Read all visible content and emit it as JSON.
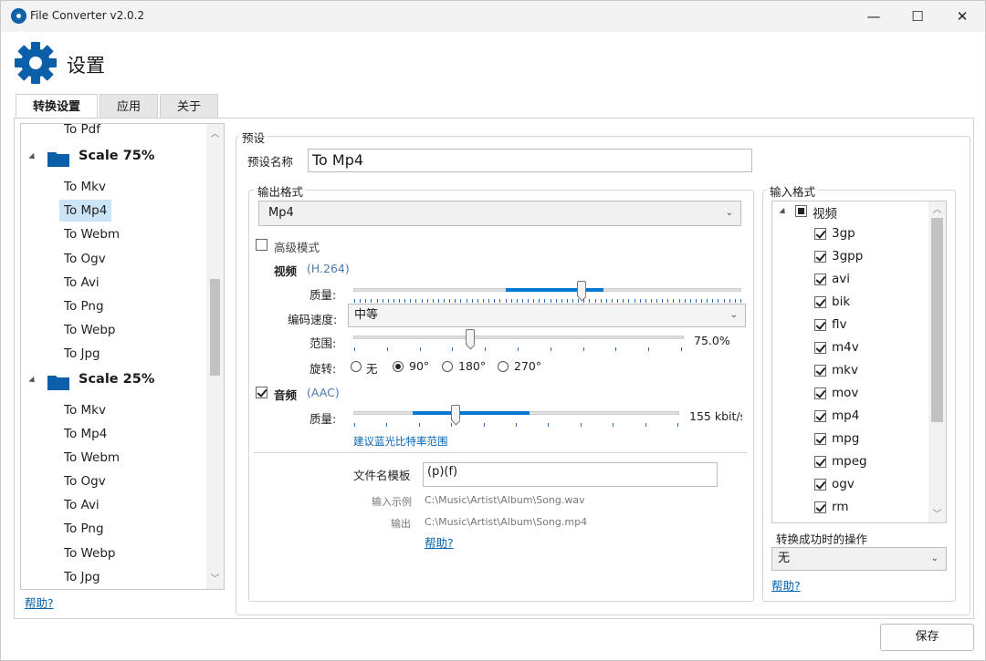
{
  "window": {
    "title": "File Converter v2.0.2",
    "minimize": "—",
    "maximize": "☐",
    "close": "✕"
  },
  "header": {
    "title": "设置",
    "icon": "gear-icon"
  },
  "tabs": [
    {
      "label": "转换设置",
      "active": true
    },
    {
      "label": "应用"
    },
    {
      "label": "关于"
    }
  ],
  "tree": {
    "top_partial": "To Pdf",
    "groups": [
      {
        "label": "Scale 75%",
        "items": [
          "To Mkv",
          "To Mp4",
          "To Webm",
          "To Ogv",
          "To Avi",
          "To Png",
          "To Webp",
          "To Jpg"
        ]
      },
      {
        "label": "Scale 25%",
        "items": [
          "To Mkv",
          "To Mp4",
          "To Webm",
          "To Ogv",
          "To Avi",
          "To Png",
          "To Webp",
          "To Jpg"
        ]
      }
    ],
    "selected": "To Mp4",
    "help": "帮助?"
  },
  "preset": {
    "legend": "预设",
    "name_label": "预设名称",
    "name_value": "To Mp4",
    "output_legend": "输出格式",
    "output_format": "Mp4",
    "advanced_label": "高级模式",
    "advanced_checked": false,
    "video": {
      "label": "视频",
      "codec": "(H.264)",
      "quality_label": "质量:",
      "quality_value": 0.45,
      "speed_label": "编码速度:",
      "speed_value": "中等",
      "range_label": "范围:",
      "range_text": "75.0%",
      "range_value": 0.35,
      "rotation_label": "旋转:",
      "rotation_options": [
        "无",
        "90°",
        "180°",
        "270°"
      ],
      "rotation_selected": "90°"
    },
    "audio": {
      "label": "音频",
      "codec": "(AAC)",
      "checked": true,
      "quality_label": "质量:",
      "quality_text": "155 kbit/s",
      "quality_value": 0.3,
      "hint_link": "建议蓝光比特率范围"
    },
    "filename": {
      "label": "文件名模板",
      "value": "(p)(f)",
      "example_input_label": "输入示例",
      "example_input": "C:\\Music\\Artist\\Album\\Song.wav",
      "example_output_label": "输出",
      "example_output": "C:\\Music\\Artist\\Album\\Song.mp4",
      "help": "帮助?"
    }
  },
  "input_formats": {
    "legend": "输入格式",
    "root_label": "视频",
    "items": [
      "3gp",
      "3gpp",
      "avi",
      "bik",
      "flv",
      "m4v",
      "mkv",
      "mov",
      "mp4",
      "mpg",
      "mpeg",
      "ogv",
      "rm"
    ],
    "on_success_label": "转换成功时的操作",
    "on_success_value": "无",
    "help": "帮助?"
  },
  "footer": {
    "save_label": "保存"
  },
  "colors": {
    "accent": "#0078d4",
    "link": "#0063b1",
    "selection": "#cce4f7"
  }
}
